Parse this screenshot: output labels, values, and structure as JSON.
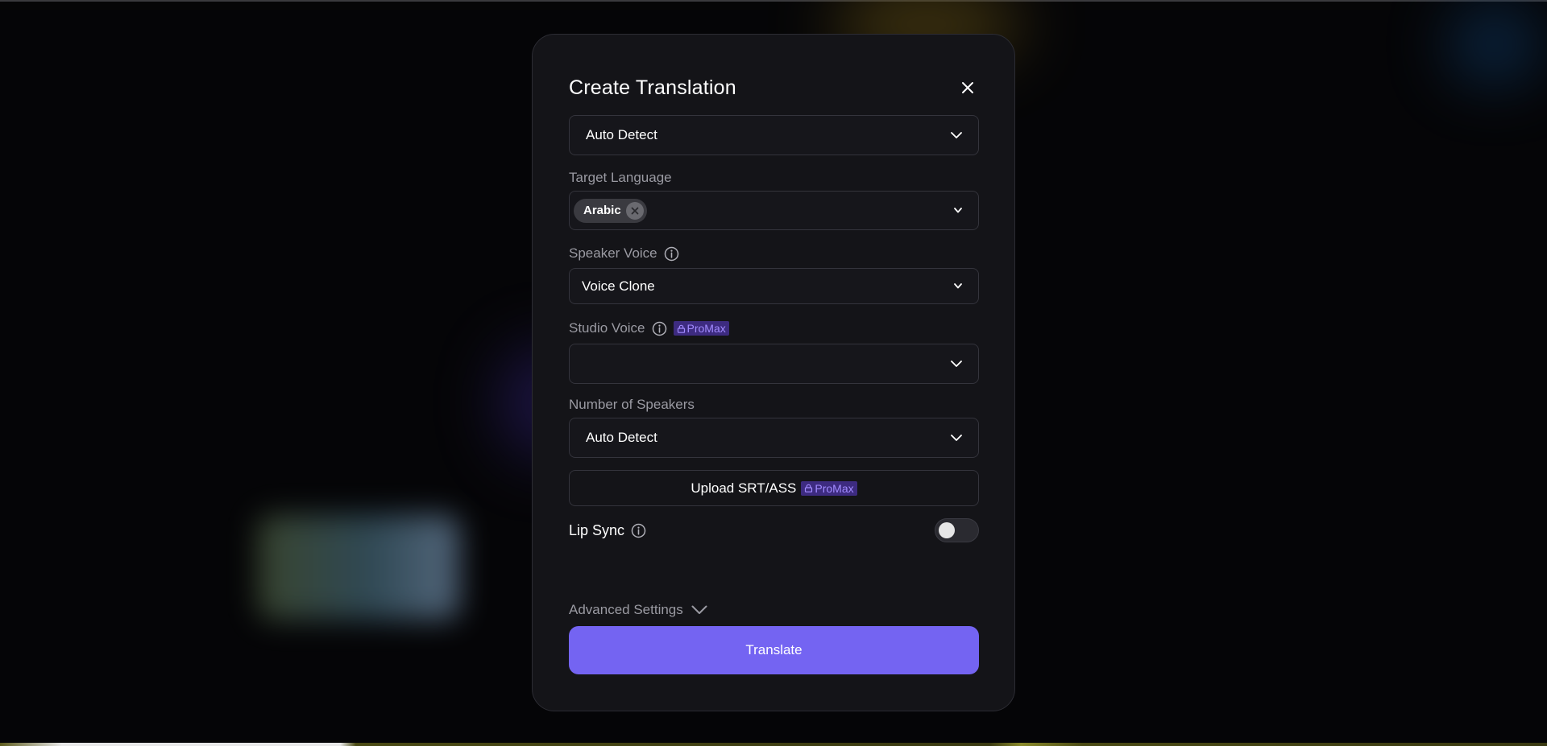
{
  "modal": {
    "title": "Create Translation"
  },
  "source_language": {
    "value": "Auto Detect"
  },
  "target_language": {
    "label": "Target Language",
    "chips": [
      "Arabic"
    ]
  },
  "speaker_voice": {
    "label": "Speaker Voice",
    "value": "Voice Clone"
  },
  "studio_voice": {
    "label": "Studio Voice",
    "badge": "ProMax",
    "value": ""
  },
  "number_of_speakers": {
    "label": "Number of Speakers",
    "value": "Auto Detect"
  },
  "upload": {
    "label": "Upload SRT/ASS",
    "badge": "ProMax"
  },
  "lip_sync": {
    "label": "Lip Sync",
    "enabled": false
  },
  "advanced": {
    "label": "Advanced Settings"
  },
  "actions": {
    "translate_label": "Translate"
  },
  "colors": {
    "accent": "#7464f2",
    "badge_bg": "#3d2b80",
    "badge_text": "#a28bff",
    "modal_bg": "#141418"
  }
}
